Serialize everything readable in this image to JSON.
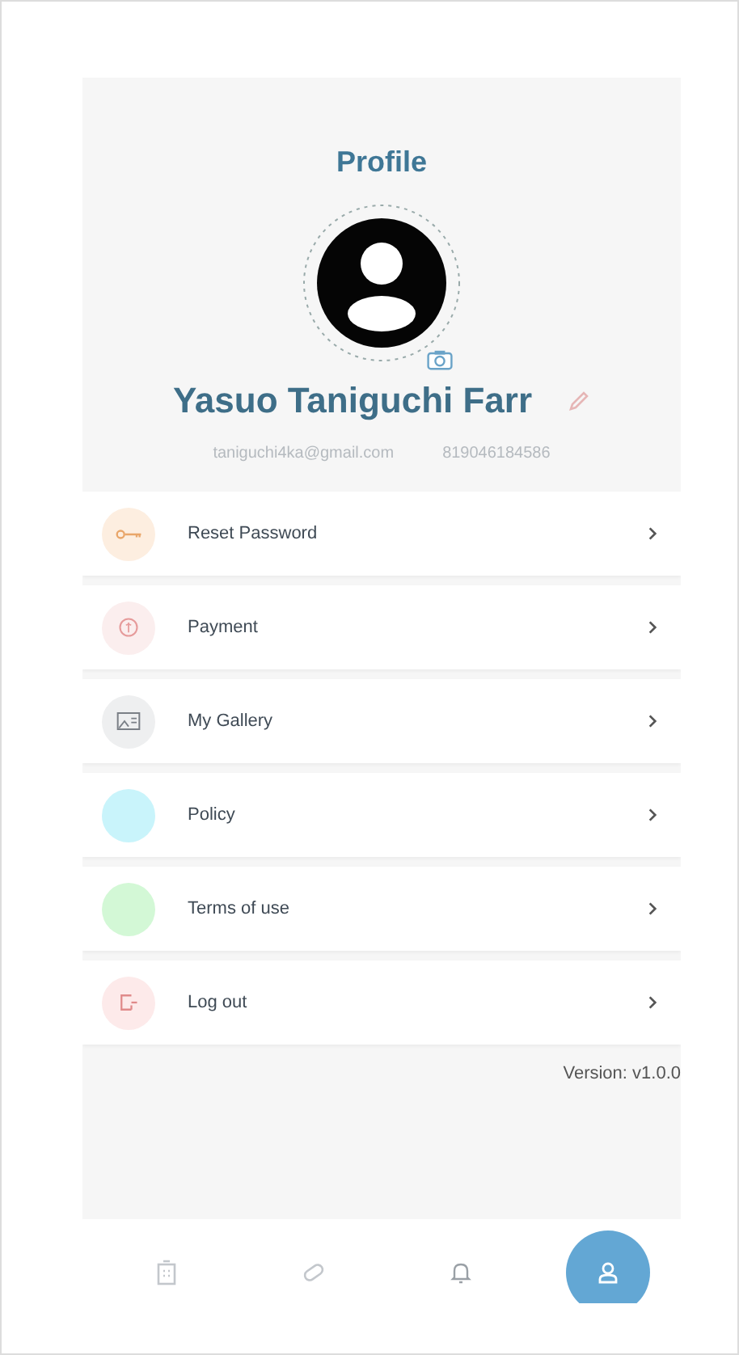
{
  "header": {
    "title": "Profile"
  },
  "profile": {
    "name": "Yasuo Taniguchi Farr",
    "email": "taniguchi4ka@gmail.com",
    "phone": "819046184586"
  },
  "menu": [
    {
      "label": "Reset Password",
      "kind": "key",
      "color": "#fdeee0"
    },
    {
      "label": "Payment",
      "kind": "coin",
      "color": "#fbeeee"
    },
    {
      "label": "My Gallery",
      "kind": "gallery",
      "color": "#eeeff0"
    },
    {
      "label": "Policy",
      "kind": "blank",
      "color": "#c9f4fb"
    },
    {
      "label": "Terms of use",
      "kind": "blank",
      "color": "#d3f8d6"
    },
    {
      "label": "Log out",
      "kind": "logout",
      "color": "#fdeaea"
    }
  ],
  "version": "Version: v1.0.0",
  "nav": [
    {
      "kind": "building",
      "selected": false
    },
    {
      "kind": "pill",
      "selected": false
    },
    {
      "kind": "bell",
      "selected": false
    },
    {
      "kind": "person",
      "selected": true
    }
  ]
}
